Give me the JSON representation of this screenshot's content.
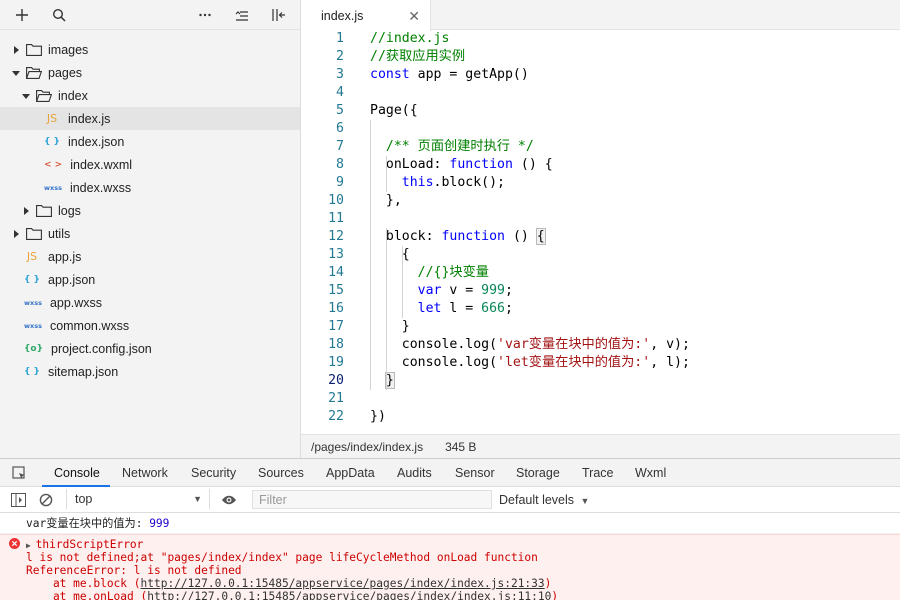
{
  "sidebar": {
    "tree": [
      {
        "label": "images",
        "type": "folder",
        "depth": 0,
        "expanded": false
      },
      {
        "label": "pages",
        "type": "folder",
        "depth": 0,
        "expanded": true
      },
      {
        "label": "index",
        "type": "folder",
        "depth": 1,
        "expanded": true
      },
      {
        "label": "index.js",
        "type": "js",
        "depth": 2,
        "selected": true
      },
      {
        "label": "index.json",
        "type": "json",
        "depth": 2
      },
      {
        "label": "index.wxml",
        "type": "wxml",
        "depth": 2
      },
      {
        "label": "index.wxss",
        "type": "wxss",
        "depth": 2
      },
      {
        "label": "logs",
        "type": "folder",
        "depth": 1,
        "expanded": false
      },
      {
        "label": "utils",
        "type": "folder",
        "depth": 0,
        "expanded": false
      },
      {
        "label": "app.js",
        "type": "js",
        "depth": 0
      },
      {
        "label": "app.json",
        "type": "json",
        "depth": 0
      },
      {
        "label": "app.wxss",
        "type": "wxss",
        "depth": 0
      },
      {
        "label": "common.wxss",
        "type": "wxss",
        "depth": 0
      },
      {
        "label": "project.config.json",
        "type": "cfg",
        "depth": 0
      },
      {
        "label": "sitemap.json",
        "type": "json",
        "depth": 0
      }
    ],
    "icons": {
      "js": "JS",
      "json": "{ }",
      "wxml": "< >",
      "wxss": "wxss",
      "cfg": "{o}"
    }
  },
  "editor": {
    "tab_label": "index.js",
    "tab_close": "✕",
    "active_line": 20,
    "lines": [
      [
        [
          "c",
          "//index.js"
        ]
      ],
      [
        [
          "c",
          "//获取应用实例"
        ]
      ],
      [
        [
          "k",
          "const"
        ],
        [
          "",
          " app = getApp()"
        ]
      ],
      [],
      [
        [
          "",
          "Page({"
        ]
      ],
      [],
      [
        [
          "",
          "  "
        ],
        [
          "c",
          "/** 页面创建时执行 */"
        ]
      ],
      [
        [
          "",
          "  onLoad: "
        ],
        [
          "k",
          "function"
        ],
        [
          "",
          " () {"
        ]
      ],
      [
        [
          "",
          "    "
        ],
        [
          "k",
          "this"
        ],
        [
          "",
          ".block();"
        ]
      ],
      [
        [
          "",
          "  },"
        ]
      ],
      [],
      [
        [
          "",
          "  block: "
        ],
        [
          "k",
          "function"
        ],
        [
          "",
          " () "
        ],
        [
          "b",
          "{"
        ]
      ],
      [
        [
          "",
          "    {"
        ]
      ],
      [
        [
          "",
          "      "
        ],
        [
          "c",
          "//{}块变量"
        ]
      ],
      [
        [
          "",
          "      "
        ],
        [
          "k",
          "var"
        ],
        [
          "",
          " v = "
        ],
        [
          "n",
          "999"
        ],
        [
          "",
          ";"
        ]
      ],
      [
        [
          "",
          "      "
        ],
        [
          "k",
          "let"
        ],
        [
          "",
          " l = "
        ],
        [
          "n",
          "666"
        ],
        [
          "",
          ";"
        ]
      ],
      [
        [
          "",
          "    }"
        ]
      ],
      [
        [
          "",
          "    console.log("
        ],
        [
          "s",
          "'var变量在块中的值为:'"
        ],
        [
          "",
          ", v);"
        ]
      ],
      [
        [
          "",
          "    console.log("
        ],
        [
          "s",
          "'let变量在块中的值为:'"
        ],
        [
          "",
          ", l);"
        ]
      ],
      [
        [
          "",
          "  "
        ],
        [
          "b",
          "}"
        ]
      ],
      [],
      [
        [
          "",
          "})"
        ]
      ]
    ],
    "status_path": "/pages/index/index.js",
    "status_size": "345 B"
  },
  "devtools": {
    "tabs": [
      "Console",
      "Network",
      "Security",
      "Sources",
      "AppData",
      "Audits",
      "Sensor",
      "Storage",
      "Trace",
      "Wxml"
    ],
    "active_tab": "Console",
    "context": "top",
    "filter_placeholder": "Filter",
    "levels": "Default levels"
  },
  "console": {
    "log_text": "var变量在块中的值为: ",
    "log_value": "999",
    "error": {
      "title": "thirdScriptError",
      "line1": "l is not defined;at \"pages/index/index\" page lifeCycleMethod onLoad function",
      "line2": "ReferenceError: l is not defined",
      "stack": [
        {
          "prefix": "    at me.block (",
          "link": "http://127.0.0.1:15485/appservice/pages/index/index.js:21:33",
          "suffix": ")"
        },
        {
          "prefix": "    at me.onLoad (",
          "link": "http://127.0.0.1:15485/appservice/pages/index/index.js:11:10",
          "suffix": ")"
        }
      ]
    }
  }
}
